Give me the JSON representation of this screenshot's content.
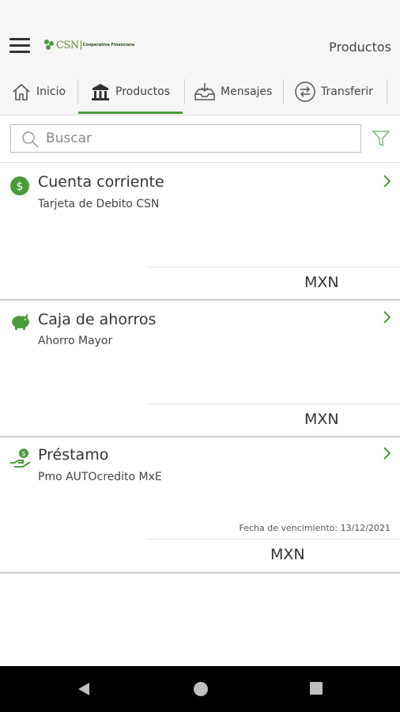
{
  "appbar": {
    "logo_brand": "CSN",
    "logo_tagline": "Cooperativa Financiera",
    "title": "Productos"
  },
  "tabs": [
    {
      "label": "Inicio",
      "icon": "home-icon"
    },
    {
      "label": "Productos",
      "icon": "bank-icon",
      "active": true
    },
    {
      "label": "Mensajes",
      "icon": "inbox-icon"
    },
    {
      "label": "Transferir",
      "icon": "transfer-icon"
    }
  ],
  "search": {
    "placeholder": "Buscar"
  },
  "accounts": [
    {
      "title": "Cuenta corriente",
      "subtitle": "Tarjeta de Debito CSN",
      "currency": "MXN",
      "icon": "dollar-icon"
    },
    {
      "title": "Caja de ahorros",
      "subtitle": "Ahorro Mayor",
      "currency": "MXN",
      "icon": "piggy-bank-icon"
    },
    {
      "title": "Préstamo",
      "subtitle": "Pmo AUTOcredito MxE",
      "due_date": "Fecha de vencimiento: 13/12/2021",
      "currency": "MXN",
      "icon": "loan-icon"
    }
  ],
  "colors": {
    "accent": "#4a9a3a",
    "navbar": "#000000"
  }
}
